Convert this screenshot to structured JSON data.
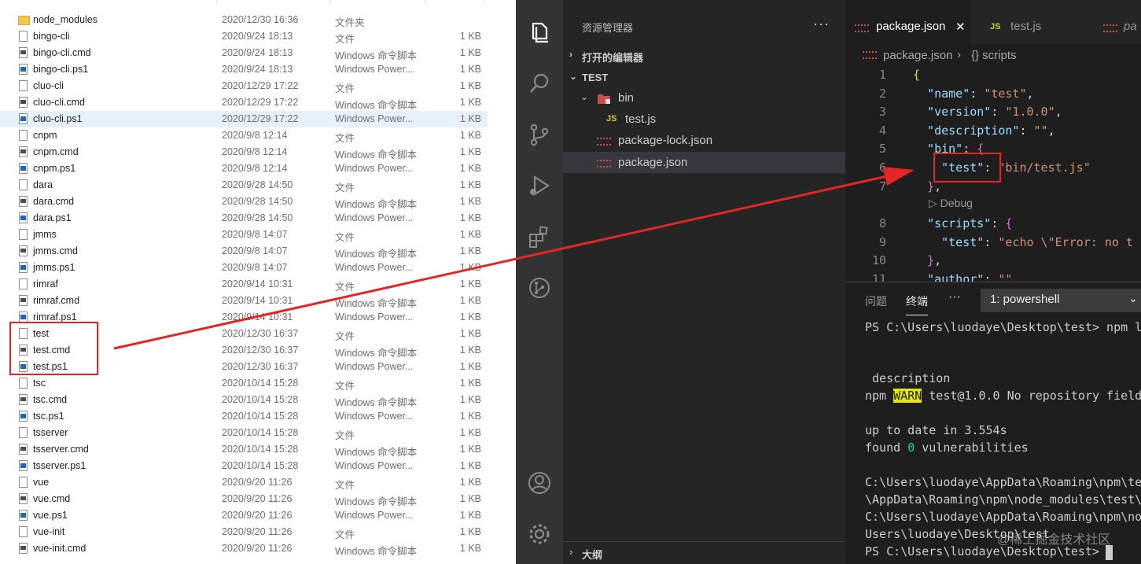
{
  "explorer": {
    "rows": [
      {
        "name": "node_modules",
        "date": "2020/12/30 16:36",
        "type": "文件夹",
        "size": "",
        "icon": "folder"
      },
      {
        "name": "bingo-cli",
        "date": "2020/9/24 18:13",
        "type": "文件",
        "size": "1 KB",
        "icon": "file"
      },
      {
        "name": "bingo-cli.cmd",
        "date": "2020/9/24 18:13",
        "type": "Windows 命令脚本",
        "size": "1 KB",
        "icon": "cmd"
      },
      {
        "name": "bingo-cli.ps1",
        "date": "2020/9/24 18:13",
        "type": "Windows Power...",
        "size": "1 KB",
        "icon": "ps"
      },
      {
        "name": "cluo-cli",
        "date": "2020/12/29 17:22",
        "type": "文件",
        "size": "1 KB",
        "icon": "file"
      },
      {
        "name": "cluo-cli.cmd",
        "date": "2020/12/29 17:22",
        "type": "Windows 命令脚本",
        "size": "1 KB",
        "icon": "cmd"
      },
      {
        "name": "cluo-cli.ps1",
        "date": "2020/12/29 17:22",
        "type": "Windows Power...",
        "size": "1 KB",
        "icon": "ps",
        "selected": true
      },
      {
        "name": "cnpm",
        "date": "2020/9/8 12:14",
        "type": "文件",
        "size": "1 KB",
        "icon": "file"
      },
      {
        "name": "cnpm.cmd",
        "date": "2020/9/8 12:14",
        "type": "Windows 命令脚本",
        "size": "1 KB",
        "icon": "cmd"
      },
      {
        "name": "cnpm.ps1",
        "date": "2020/9/8 12:14",
        "type": "Windows Power...",
        "size": "1 KB",
        "icon": "ps"
      },
      {
        "name": "dara",
        "date": "2020/9/28 14:50",
        "type": "文件",
        "size": "1 KB",
        "icon": "file"
      },
      {
        "name": "dara.cmd",
        "date": "2020/9/28 14:50",
        "type": "Windows 命令脚本",
        "size": "1 KB",
        "icon": "cmd"
      },
      {
        "name": "dara.ps1",
        "date": "2020/9/28 14:50",
        "type": "Windows Power...",
        "size": "1 KB",
        "icon": "ps"
      },
      {
        "name": "jmms",
        "date": "2020/9/8 14:07",
        "type": "文件",
        "size": "1 KB",
        "icon": "file"
      },
      {
        "name": "jmms.cmd",
        "date": "2020/9/8 14:07",
        "type": "Windows 命令脚本",
        "size": "1 KB",
        "icon": "cmd"
      },
      {
        "name": "jmms.ps1",
        "date": "2020/9/8 14:07",
        "type": "Windows Power...",
        "size": "1 KB",
        "icon": "ps"
      },
      {
        "name": "rimraf",
        "date": "2020/9/14 10:31",
        "type": "文件",
        "size": "1 KB",
        "icon": "file"
      },
      {
        "name": "rimraf.cmd",
        "date": "2020/9/14 10:31",
        "type": "Windows 命令脚本",
        "size": "1 KB",
        "icon": "cmd"
      },
      {
        "name": "rimraf.ps1",
        "date": "2020/9/14 10:31",
        "type": "Windows Power...",
        "size": "1 KB",
        "icon": "ps"
      },
      {
        "name": "test",
        "date": "2020/12/30 16:37",
        "type": "文件",
        "size": "1 KB",
        "icon": "file"
      },
      {
        "name": "test.cmd",
        "date": "2020/12/30 16:37",
        "type": "Windows 命令脚本",
        "size": "1 KB",
        "icon": "cmd"
      },
      {
        "name": "test.ps1",
        "date": "2020/12/30 16:37",
        "type": "Windows Power...",
        "size": "1 KB",
        "icon": "ps"
      },
      {
        "name": "tsc",
        "date": "2020/10/14 15:28",
        "type": "文件",
        "size": "1 KB",
        "icon": "file"
      },
      {
        "name": "tsc.cmd",
        "date": "2020/10/14 15:28",
        "type": "Windows 命令脚本",
        "size": "1 KB",
        "icon": "cmd"
      },
      {
        "name": "tsc.ps1",
        "date": "2020/10/14 15:28",
        "type": "Windows Power...",
        "size": "1 KB",
        "icon": "ps"
      },
      {
        "name": "tsserver",
        "date": "2020/10/14 15:28",
        "type": "文件",
        "size": "1 KB",
        "icon": "file"
      },
      {
        "name": "tsserver.cmd",
        "date": "2020/10/14 15:28",
        "type": "Windows 命令脚本",
        "size": "1 KB",
        "icon": "cmd"
      },
      {
        "name": "tsserver.ps1",
        "date": "2020/10/14 15:28",
        "type": "Windows Power...",
        "size": "1 KB",
        "icon": "ps"
      },
      {
        "name": "vue",
        "date": "2020/9/20 11:26",
        "type": "文件",
        "size": "1 KB",
        "icon": "file"
      },
      {
        "name": "vue.cmd",
        "date": "2020/9/20 11:26",
        "type": "Windows 命令脚本",
        "size": "1 KB",
        "icon": "cmd"
      },
      {
        "name": "vue.ps1",
        "date": "2020/9/20 11:26",
        "type": "Windows Power...",
        "size": "1 KB",
        "icon": "ps"
      },
      {
        "name": "vue-init",
        "date": "2020/9/20 11:26",
        "type": "文件",
        "size": "1 KB",
        "icon": "file"
      },
      {
        "name": "vue-init.cmd",
        "date": "2020/9/20 11:26",
        "type": "Windows 命令脚本",
        "size": "1 KB",
        "icon": "cmd"
      }
    ]
  },
  "vscode": {
    "sidebar": {
      "title": "资源管理器",
      "more": "···",
      "open_editors": "打开的编辑器",
      "folder": "TEST",
      "tree": {
        "bin": "bin",
        "test_js": "test.js",
        "lock": "package-lock.json",
        "pkg": "package.json"
      },
      "outline": "大纲"
    },
    "tabs": {
      "active": "package.json",
      "close": "✕",
      "second": "test.js",
      "third": "pa"
    },
    "breadcrumb": {
      "file": "package.json",
      "sep": "›",
      "symbol": "{} scripts"
    },
    "codelens": "▷ Debug",
    "code": [
      {
        "ln": "1"
      },
      {
        "ln": "2"
      },
      {
        "ln": "3"
      },
      {
        "ln": "4"
      },
      {
        "ln": "5"
      },
      {
        "ln": "6"
      },
      {
        "ln": "7"
      },
      {
        "ln": "8"
      },
      {
        "ln": "9"
      },
      {
        "ln": "10"
      },
      {
        "ln": "11"
      }
    ],
    "panel": {
      "tab_problems": "问题",
      "tab_terminal": "终端",
      "more": "···",
      "terminal_select": "1: powershell",
      "lines": {
        "l1": "PS C:\\Users\\luodaye\\Desktop\\test> npm l",
        "l2": " description",
        "l3_pre": "npm ",
        "l3_warn": "WARN",
        "l3_post": " test@1.0.0 No repository field",
        "l4": "up to date in 3.554s",
        "l5_pre": "found ",
        "l5_zero": "0",
        "l5_post": " vulnerabilities",
        "l6": "C:\\Users\\luodaye\\AppData\\Roaming\\npm\\te",
        "l7": "\\AppData\\Roaming\\npm\\node_modules\\test\\",
        "l8": "C:\\Users\\luodaye\\AppData\\Roaming\\npm\\no",
        "l9": "Users\\luodaye\\Desktop\\test",
        "l10": "PS C:\\Users\\luodaye\\Desktop\\test> "
      },
      "watermark": "@稀土掘金技术社区"
    }
  },
  "colors": {
    "annotation": "#e02626",
    "accent": "#cbcb41"
  }
}
